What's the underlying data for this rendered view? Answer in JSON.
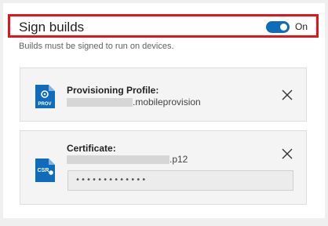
{
  "section": {
    "title": "Sign builds",
    "toggle_state": "On",
    "description": "Builds must be signed to run on devices."
  },
  "profile_card": {
    "icon_name": "prov-file-icon",
    "icon_text": "PROV",
    "label": "Provisioning Profile:",
    "file_suffix": ".mobileprovision"
  },
  "certificate_card": {
    "icon_name": "csr-file-icon",
    "icon_text": "CSR",
    "label": "Certificate:",
    "file_suffix": ".p12",
    "password_value": "•••••••••••••"
  },
  "colors": {
    "accent": "#0f6cbd",
    "highlight": "#e4141b"
  }
}
